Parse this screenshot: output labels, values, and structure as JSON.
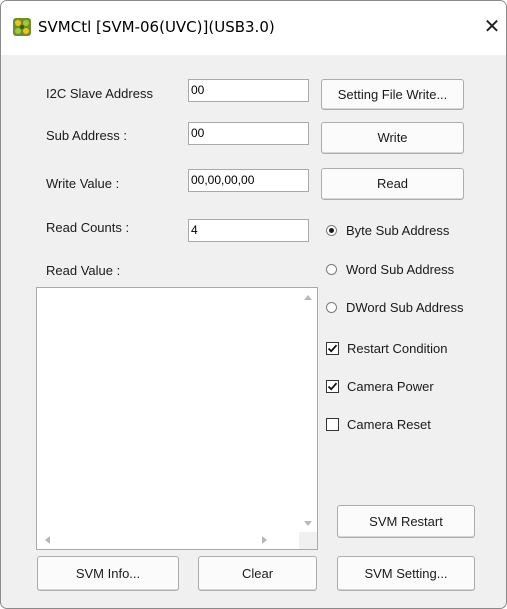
{
  "window": {
    "title": "SVMCtl [SVM-06(UVC)](USB3.0)",
    "close_glyph": "✕",
    "icon": "svmctl-app-icon"
  },
  "fields": {
    "i2c_slave_address": {
      "label": "I2C Slave Address",
      "value": "00"
    },
    "sub_address": {
      "label": "Sub Address :",
      "value": "00"
    },
    "write_value": {
      "label": "Write Value :",
      "value": "00,00,00,00"
    },
    "read_counts": {
      "label": "Read Counts :",
      "value": "4"
    },
    "read_value": {
      "label": "Read Value :"
    }
  },
  "buttons": {
    "setting_file_write": "Setting File Write...",
    "write": "Write",
    "read": "Read",
    "svm_restart": "SVM Restart",
    "svm_info": "SVM Info...",
    "clear": "Clear",
    "svm_setting": "SVM Setting..."
  },
  "sub_address_mode": {
    "options": [
      "Byte Sub Address",
      "Word Sub Address",
      "DWord Sub Address"
    ],
    "selected": "Byte Sub Address"
  },
  "checkboxes": [
    {
      "label": "Restart Condition",
      "checked": true
    },
    {
      "label": "Camera Power",
      "checked": true
    },
    {
      "label": "Camera Reset",
      "checked": false
    }
  ],
  "read_value_list": {
    "items": []
  }
}
